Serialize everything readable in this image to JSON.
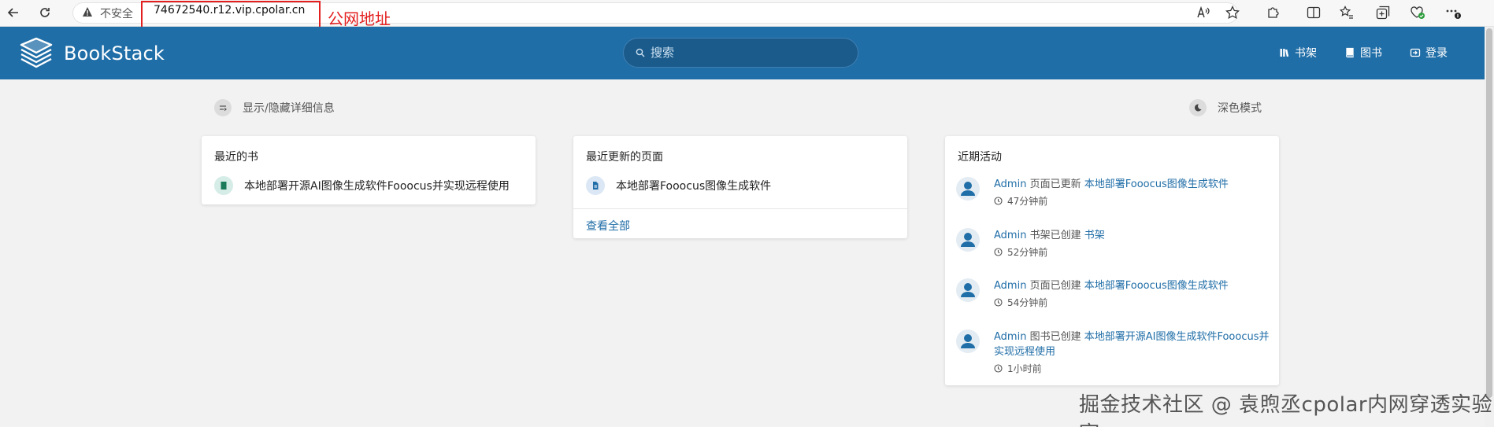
{
  "browser": {
    "insecure_label": "不安全",
    "url": "74672540.r12.vip.cpolar.cn",
    "annotation": "公网地址"
  },
  "header": {
    "app_name": "BookStack",
    "search_placeholder": "搜索",
    "links": [
      "书架",
      "图书",
      "登录"
    ],
    "color": "#206ea7"
  },
  "toggles": {
    "details": "显示/隐藏详细信息",
    "dark_mode": "深色模式"
  },
  "recent_books": {
    "title": "最近的书",
    "items": [
      "本地部署开源AI图像生成软件Fooocus并实现远程使用"
    ]
  },
  "recent_pages": {
    "title": "最近更新的页面",
    "items": [
      "本地部署Fooocus图像生成软件"
    ],
    "view_all": "查看全部"
  },
  "activity": {
    "title": "近期活动",
    "items": [
      {
        "user": "Admin",
        "action": "页面已更新",
        "target": "本地部署Fooocus图像生成软件",
        "time": "47分钟前"
      },
      {
        "user": "Admin",
        "action": "书架已创建",
        "target": "书架",
        "time": "52分钟前"
      },
      {
        "user": "Admin",
        "action": "页面已创建",
        "target": "本地部署Fooocus图像生成软件",
        "time": "54分钟前"
      },
      {
        "user": "Admin",
        "action": "图书已创建",
        "target": "本地部署开源AI图像生成软件Fooocus并实现远程使用",
        "time": "1小时前"
      }
    ]
  },
  "watermark": "掘金技术社区 @ 袁煦丞cpolar内网穿透实验室"
}
